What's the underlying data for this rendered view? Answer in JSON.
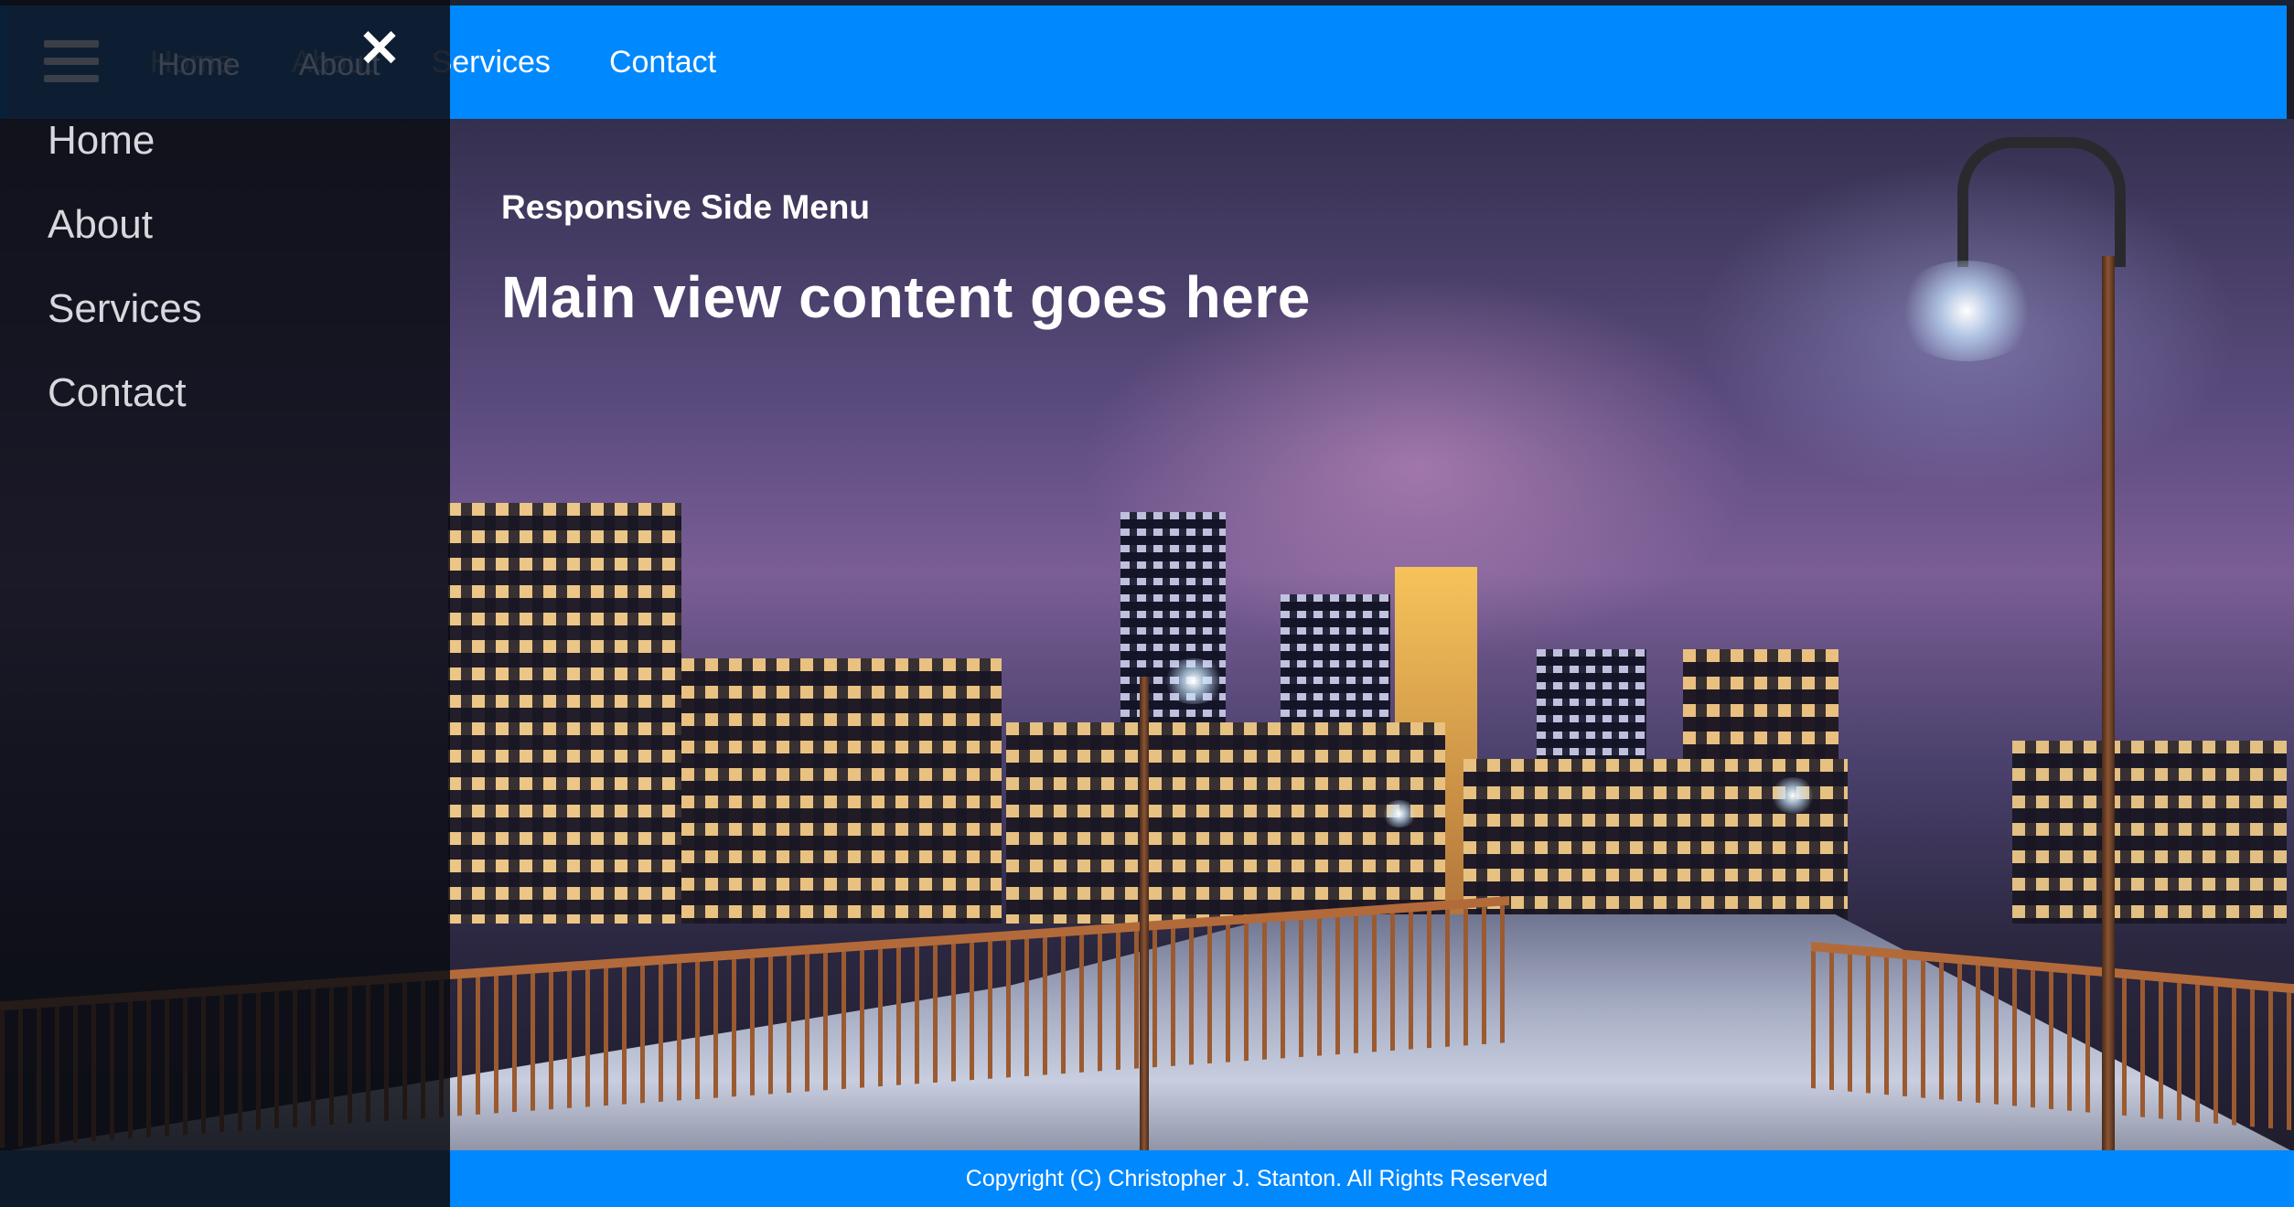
{
  "navbar": {
    "links": [
      "Home",
      "About",
      "Services",
      "Contact"
    ]
  },
  "side_menu": {
    "close_icon": "close-icon",
    "menu_icon": "hamburger-menu-icon",
    "items": [
      "Home",
      "About",
      "Services",
      "Contact"
    ]
  },
  "main": {
    "subtitle": "Responsive Side Menu",
    "headline": "Main view content goes here"
  },
  "footer": {
    "copyright": "Copyright (C) Christopher J. Stanton. All Rights Reserved"
  },
  "colors": {
    "navbar_bg": "#0088ff",
    "footer_bg": "#0088ff",
    "side_menu_bg": "rgba(10,12,18,0.84)",
    "text": "#ffffff"
  }
}
